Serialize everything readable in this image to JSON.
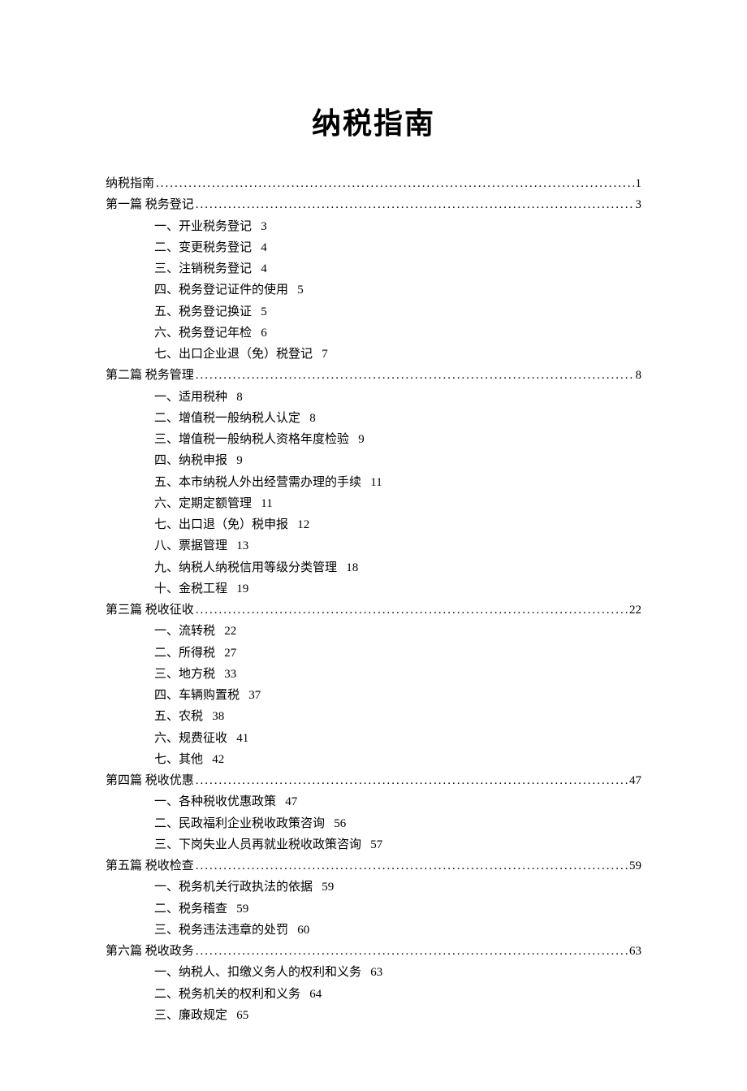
{
  "title": "纳税指南",
  "toc": [
    {
      "type": "main",
      "label": "纳税指南",
      "page": "1",
      "subs": []
    },
    {
      "type": "main",
      "label": "第一篇 税务登记",
      "page": "3",
      "subs": [
        {
          "label": "一、开业税务登记",
          "page": "3"
        },
        {
          "label": "二、变更税务登记",
          "page": "4"
        },
        {
          "label": "三、注销税务登记",
          "page": "4"
        },
        {
          "label": "四、税务登记证件的使用",
          "page": "5"
        },
        {
          "label": "五、税务登记换证",
          "page": "5"
        },
        {
          "label": "六、税务登记年检",
          "page": "6"
        },
        {
          "label": "七、出口企业退（免）税登记",
          "page": "7"
        }
      ]
    },
    {
      "type": "main",
      "label": "第二篇 税务管理",
      "page": "8",
      "subs": [
        {
          "label": "一、适用税种",
          "page": "8"
        },
        {
          "label": "二、增值税一般纳税人认定",
          "page": "8"
        },
        {
          "label": "三、增值税一般纳税人资格年度检验",
          "page": "9"
        },
        {
          "label": "四、纳税申报",
          "page": "9"
        },
        {
          "label": "五、本市纳税人外出经营需办理的手续",
          "page": "11"
        },
        {
          "label": "六、定期定额管理",
          "page": "11"
        },
        {
          "label": "七、出口退（免）税申报",
          "page": "12"
        },
        {
          "label": "八、票据管理",
          "page": "13"
        },
        {
          "label": "九、纳税人纳税信用等级分类管理",
          "page": "18"
        },
        {
          "label": "十、金税工程",
          "page": "19"
        }
      ]
    },
    {
      "type": "main",
      "label": "第三篇 税收征收",
      "page": "22",
      "subs": [
        {
          "label": "一、流转税",
          "page": "22"
        },
        {
          "label": "二、所得税",
          "page": "27"
        },
        {
          "label": "三、地方税",
          "page": "33"
        },
        {
          "label": "四、车辆购置税",
          "page": "37"
        },
        {
          "label": "五、农税",
          "page": "38"
        },
        {
          "label": "六、规费征收",
          "page": "41"
        },
        {
          "label": "七、其他",
          "page": "42"
        }
      ]
    },
    {
      "type": "main",
      "label": "第四篇 税收优惠",
      "page": "47",
      "subs": [
        {
          "label": "一、各种税收优惠政策",
          "page": "47"
        },
        {
          "label": "二、民政福利企业税收政策咨询",
          "page": "56"
        },
        {
          "label": "三、下岗失业人员再就业税收政策咨询",
          "page": "57"
        }
      ]
    },
    {
      "type": "main",
      "label": "第五篇 税收检查",
      "page": "59",
      "subs": [
        {
          "label": "一、税务机关行政执法的依据",
          "page": "59"
        },
        {
          "label": "二、税务稽查",
          "page": "59"
        },
        {
          "label": "三、税务违法违章的处罚",
          "page": "60"
        }
      ]
    },
    {
      "type": "main",
      "label": "第六篇 税收政务",
      "page": "63",
      "subs": [
        {
          "label": "一、纳税人、扣缴义务人的权利和义务",
          "page": "63"
        },
        {
          "label": "二、税务机关的权利和义务",
          "page": "64"
        },
        {
          "label": "三、廉政规定",
          "page": "65"
        }
      ]
    }
  ]
}
